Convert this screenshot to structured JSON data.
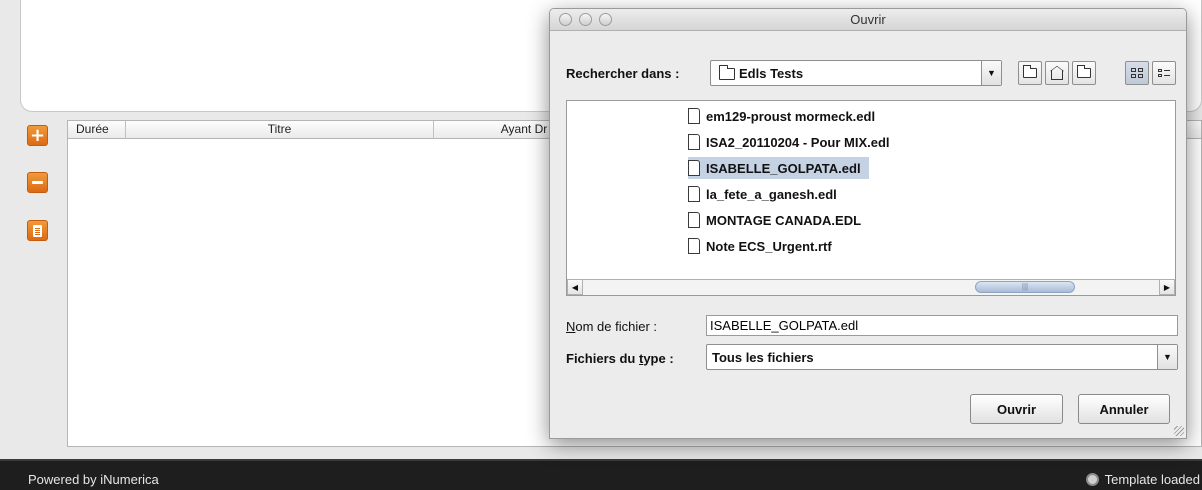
{
  "background_app": {
    "table": {
      "columns": [
        "Durée",
        "Titre",
        "Ayant Dr"
      ]
    },
    "side_buttons": [
      {
        "icon": "plus-icon",
        "glyph": "+"
      },
      {
        "icon": "minus-icon"
      },
      {
        "icon": "document-icon"
      }
    ],
    "footer": {
      "powered_by": "Powered by iNumerica",
      "status": "Template loaded"
    },
    "colors": {
      "accent_orange": "#e8801e",
      "footer_bg": "#1e1e1e"
    }
  },
  "dialog": {
    "title": "Ouvrir",
    "look_in": {
      "label": "Rechercher dans :",
      "value": "Edls Tests"
    },
    "toolbar": [
      "up-folder-icon",
      "home-icon",
      "new-folder-icon",
      "list-view-icon",
      "details-view-icon"
    ],
    "files": [
      {
        "name": "em129-proust mormeck.edl",
        "selected": false
      },
      {
        "name": "ISA2_20110204 - Pour MIX.edl",
        "selected": false
      },
      {
        "name": "ISABELLE_GOLPATA.edl",
        "selected": true
      },
      {
        "name": "la_fete_a_ganesh.edl",
        "selected": false
      },
      {
        "name": "MONTAGE CANADA.EDL",
        "selected": false
      },
      {
        "name": "Note ECS_Urgent.rtf",
        "selected": false
      }
    ],
    "file_name": {
      "label_mnemonic": "N",
      "label_rest": "om de fichier :",
      "value": "ISABELLE_GOLPATA.edl"
    },
    "file_type": {
      "label_pre": "Fichiers du ",
      "label_mnemonic": "t",
      "label_post": "ype :",
      "value": "Tous les fichiers"
    },
    "buttons": {
      "open": "Ouvrir",
      "cancel": "Annuler"
    },
    "colors": {
      "selection": "#c4d2e4"
    }
  }
}
